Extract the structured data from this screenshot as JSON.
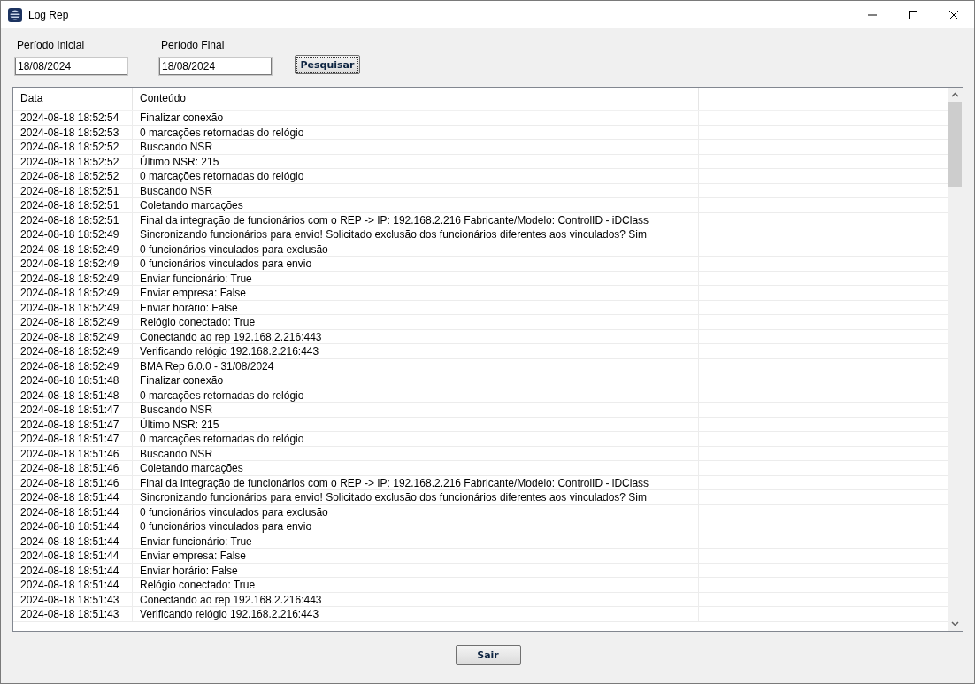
{
  "window": {
    "title": "Log Rep"
  },
  "filters": [
    {
      "label": "Período Inicial",
      "value": "18/08/2024"
    },
    {
      "label": "Período Final",
      "value": "18/08/2024"
    }
  ],
  "search_button": "Pesquisar",
  "table": {
    "columns": [
      "Data",
      "Conteúdo"
    ],
    "rows": [
      {
        "date": "2024-08-18 18:52:54",
        "content": "Finalizar conexão"
      },
      {
        "date": "2024-08-18 18:52:53",
        "content": "0 marcações retornadas do relógio"
      },
      {
        "date": "2024-08-18 18:52:52",
        "content": "Buscando NSR"
      },
      {
        "date": "2024-08-18 18:52:52",
        "content": "Último NSR: 215"
      },
      {
        "date": "2024-08-18 18:52:52",
        "content": "0 marcações retornadas do relógio"
      },
      {
        "date": "2024-08-18 18:52:51",
        "content": "Buscando NSR"
      },
      {
        "date": "2024-08-18 18:52:51",
        "content": "Coletando marcações"
      },
      {
        "date": "2024-08-18 18:52:51",
        "content": "Final da integração de funcionários com o REP -> IP: 192.168.2.216 Fabricante/Modelo: ControlID - iDClass"
      },
      {
        "date": "2024-08-18 18:52:49",
        "content": "Sincronizando funcionários para envio! Solicitado exclusão dos funcionários diferentes aos vinculados? Sim"
      },
      {
        "date": "2024-08-18 18:52:49",
        "content": "0 funcionários vinculados para exclusão"
      },
      {
        "date": "2024-08-18 18:52:49",
        "content": "0 funcionários vinculados para envio"
      },
      {
        "date": "2024-08-18 18:52:49",
        "content": "Enviar funcionário: True"
      },
      {
        "date": "2024-08-18 18:52:49",
        "content": "Enviar empresa: False"
      },
      {
        "date": "2024-08-18 18:52:49",
        "content": "Enviar horário: False"
      },
      {
        "date": "2024-08-18 18:52:49",
        "content": "Relógio conectado: True"
      },
      {
        "date": "2024-08-18 18:52:49",
        "content": "Conectando ao rep 192.168.2.216:443"
      },
      {
        "date": "2024-08-18 18:52:49",
        "content": "Verificando relógio 192.168.2.216:443"
      },
      {
        "date": "2024-08-18 18:52:49",
        "content": "BMA Rep 6.0.0 - 31/08/2024"
      },
      {
        "date": "2024-08-18 18:51:48",
        "content": "Finalizar conexão"
      },
      {
        "date": "2024-08-18 18:51:48",
        "content": "0 marcações retornadas do relógio"
      },
      {
        "date": "2024-08-18 18:51:47",
        "content": "Buscando NSR"
      },
      {
        "date": "2024-08-18 18:51:47",
        "content": "Último NSR: 215"
      },
      {
        "date": "2024-08-18 18:51:47",
        "content": "0 marcações retornadas do relógio"
      },
      {
        "date": "2024-08-18 18:51:46",
        "content": "Buscando NSR"
      },
      {
        "date": "2024-08-18 18:51:46",
        "content": "Coletando marcações"
      },
      {
        "date": "2024-08-18 18:51:46",
        "content": "Final da integração de funcionários com o REP -> IP: 192.168.2.216 Fabricante/Modelo: ControlID - iDClass"
      },
      {
        "date": "2024-08-18 18:51:44",
        "content": "Sincronizando funcionários para envio! Solicitado exclusão dos funcionários diferentes aos vinculados? Sim"
      },
      {
        "date": "2024-08-18 18:51:44",
        "content": "0 funcionários vinculados para exclusão"
      },
      {
        "date": "2024-08-18 18:51:44",
        "content": "0 funcionários vinculados para envio"
      },
      {
        "date": "2024-08-18 18:51:44",
        "content": "Enviar funcionário: True"
      },
      {
        "date": "2024-08-18 18:51:44",
        "content": "Enviar empresa: False"
      },
      {
        "date": "2024-08-18 18:51:44",
        "content": "Enviar horário: False"
      },
      {
        "date": "2024-08-18 18:51:44",
        "content": "Relógio conectado: True"
      },
      {
        "date": "2024-08-18 18:51:43",
        "content": "Conectando ao rep 192.168.2.216:443"
      },
      {
        "date": "2024-08-18 18:51:43",
        "content": "Verificando relógio 192.168.2.216:443"
      }
    ]
  },
  "exit_button": "Sair"
}
